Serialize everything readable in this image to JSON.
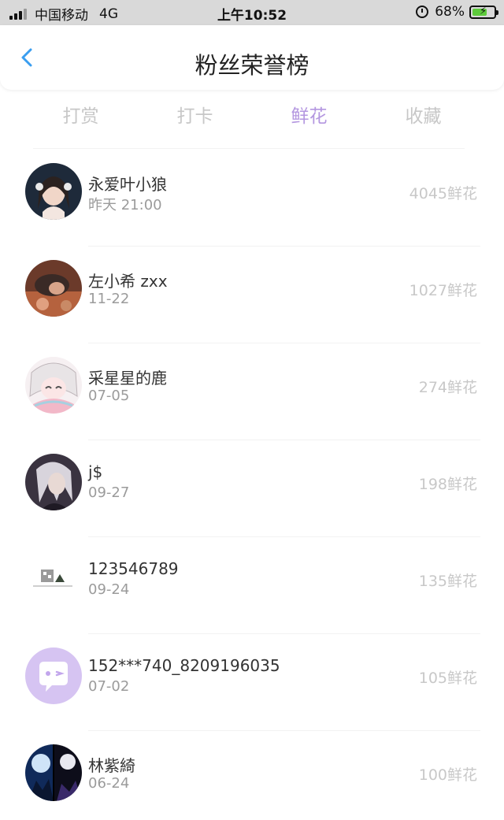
{
  "status_bar": {
    "carrier": "中国移动",
    "network": "4G",
    "time": "上午10:52",
    "battery": "68%",
    "battery_level": 0.68
  },
  "nav": {
    "title": "粉丝荣誉榜",
    "back_icon": "chevron-left-icon"
  },
  "colors": {
    "accent": "#b497e0",
    "back_arrow": "#3a9ef0",
    "muted": "#c8c8c8"
  },
  "tabs": [
    {
      "label": "打赏",
      "active": false
    },
    {
      "label": "打卡",
      "active": false
    },
    {
      "label": "鲜花",
      "active": true
    },
    {
      "label": "收藏",
      "active": false
    }
  ],
  "fans": [
    {
      "name": "永爱叶小狼",
      "date": "昨天 21:00",
      "amount": "4045鲜花"
    },
    {
      "name": "左小希 zxx",
      "date": "11-22",
      "amount": "1027鲜花"
    },
    {
      "name": "采星星的鹿",
      "date": "07-05",
      "amount": "274鲜花"
    },
    {
      "name": "j$",
      "date": "09-27",
      "amount": "198鲜花"
    },
    {
      "name": "123546789",
      "date": "09-24",
      "amount": "135鲜花"
    },
    {
      "name": "152***740_8209196035",
      "date": "07-02",
      "amount": "105鲜花"
    },
    {
      "name": "林紫綺",
      "date": "06-24",
      "amount": "100鲜花"
    }
  ]
}
